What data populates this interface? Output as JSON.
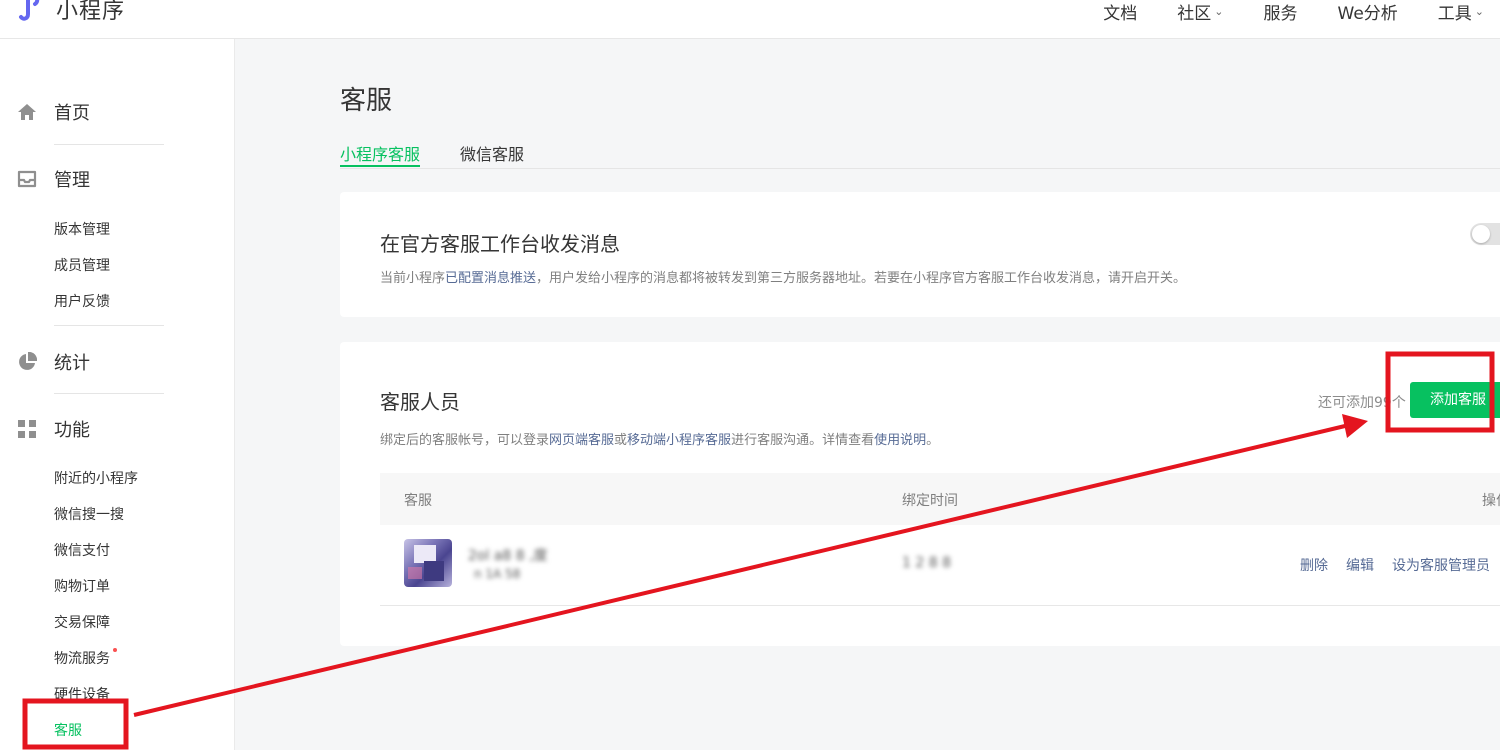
{
  "brand": {
    "name": "小程序"
  },
  "top_nav": [
    {
      "label": "文档",
      "has_menu": false
    },
    {
      "label": "社区",
      "has_menu": true
    },
    {
      "label": "服务",
      "has_menu": false
    },
    {
      "label": "We分析",
      "has_menu": false
    },
    {
      "label": "工具",
      "has_menu": true
    }
  ],
  "sidebar": {
    "sections": [
      {
        "label": "首页",
        "icon": "home-icon"
      },
      {
        "label": "管理",
        "icon": "inbox-icon",
        "items": [
          "版本管理",
          "成员管理",
          "用户反馈"
        ]
      },
      {
        "label": "统计",
        "icon": "pie-chart-icon"
      },
      {
        "label": "功能",
        "icon": "grid-icon",
        "items": [
          "附近的小程序",
          "微信搜一搜",
          "微信支付",
          "购物订单",
          "交易保障",
          "物流服务",
          "硬件设备",
          "客服"
        ]
      }
    ],
    "active_item": "客服",
    "badge_item": "物流服务"
  },
  "page": {
    "title": "客服",
    "tabs": [
      {
        "label": "小程序客服",
        "active": true
      },
      {
        "label": "微信客服",
        "active": false
      }
    ]
  },
  "official_workbench": {
    "title": "在官方客服工作台收发消息",
    "desc_pre": "当前小程序",
    "desc_link": "已配置消息推送",
    "desc_post": "，用户发给小程序的消息都将被转发到第三方服务器地址。若要在小程序官方客服工作台收发消息，请开启开关。",
    "toggle_on": false
  },
  "staff": {
    "title": "客服人员",
    "remaining_text": "还可添加99个",
    "add_button": "添加客服",
    "desc_1": "绑定后的客服帐号，可以登录",
    "link_1": "网页端客服",
    "desc_2": "或",
    "link_2": "移动端小程序客服",
    "desc_3": "进行客服沟通。详情查看",
    "link_3": "使用说明",
    "desc_4": "。",
    "columns": {
      "staff": "客服",
      "bind_time": "绑定时间",
      "actions": "操作"
    },
    "rows": [
      {
        "name": "2ol a8 8 ,度",
        "account": "n  1A 58",
        "bind_time": "1 2  8   8",
        "actions": [
          "删除",
          "编辑",
          "设为客服管理员"
        ]
      }
    ]
  },
  "colors": {
    "accent": "#07c160",
    "link": "#576b95",
    "annotation": "#e4151f"
  }
}
